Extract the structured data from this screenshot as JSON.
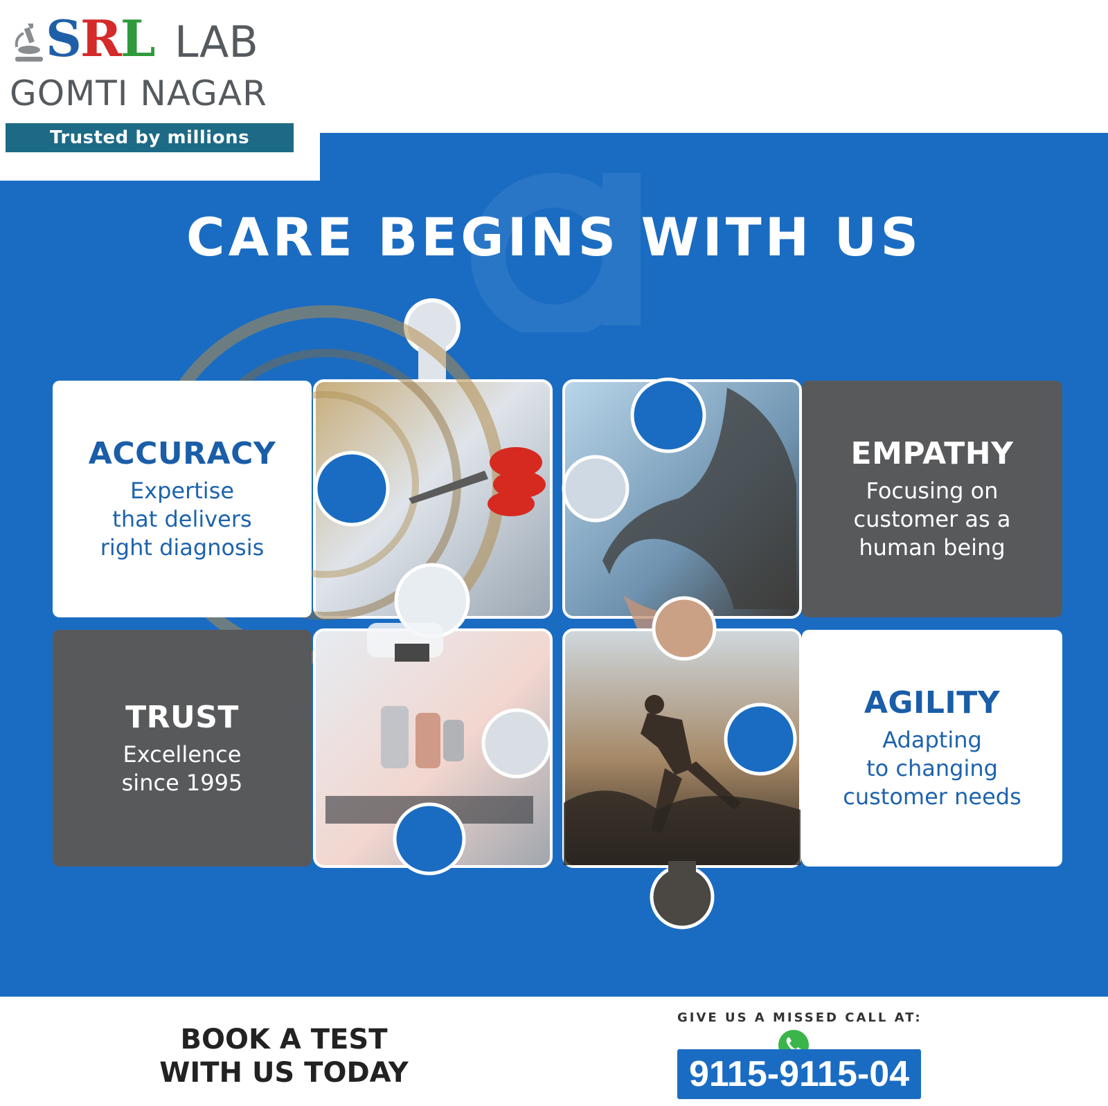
{
  "brand": {
    "name_s": "S",
    "name_r": "R",
    "name_l": "L",
    "suffix": "LAB",
    "location": "GOMTI NAGAR",
    "tagline": "Trusted by millions"
  },
  "headline": "CARE BEGINS WITH US",
  "cards": {
    "accuracy": {
      "title": "ACCURACY",
      "line1": "Expertise",
      "line2": "that delivers",
      "line3": "right diagnosis"
    },
    "empathy": {
      "title": "EMPATHY",
      "line1": "Focusing on",
      "line2": "customer as a",
      "line3": "human being"
    },
    "trust": {
      "title": "TRUST",
      "line1": "Excellence",
      "line2": "since 1995"
    },
    "agility": {
      "title": "AGILITY",
      "line1": "Adapting",
      "line2": "to changing",
      "line3": "customer needs"
    }
  },
  "footer": {
    "cta_line1": "BOOK A TEST",
    "cta_line2": "WITH US TODAY",
    "missed_call_label": "GIVE US A MISSED CALL AT:",
    "phone": "9115-9115-04"
  },
  "colors": {
    "primary_blue": "#1a6cc2",
    "card_gray": "#58595b",
    "banner_teal": "#1d6a86",
    "logo_red": "#d42a2a",
    "logo_green": "#2f9a3c",
    "whatsapp_green": "#3bb54a"
  },
  "icons": [
    "microscope-icon",
    "whatsapp-phone-icon"
  ]
}
